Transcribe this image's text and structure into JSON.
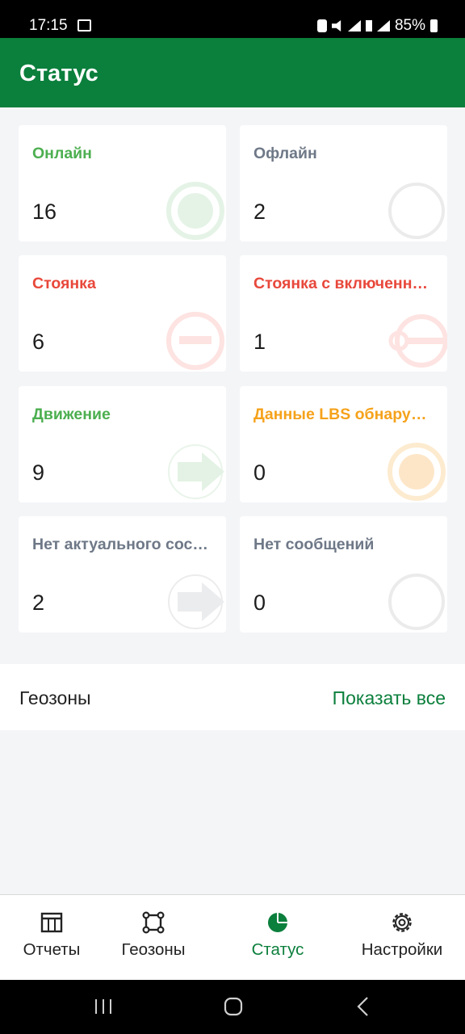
{
  "status_bar": {
    "time": "17:15",
    "battery": "85%"
  },
  "app_bar": {
    "title": "Статус"
  },
  "cards": [
    {
      "label": "Онлайн",
      "value": "16",
      "color": "#4caf50",
      "icon": "online-circle-icon"
    },
    {
      "label": "Офлайн",
      "value": "2",
      "color": "#6e7887",
      "icon": "offline-circle-icon"
    },
    {
      "label": "Стоянка",
      "value": "6",
      "color": "#e8483b",
      "icon": "parking-minus-icon"
    },
    {
      "label": "Стоянка с включенным зажиганием",
      "value": "1",
      "color": "#e8483b",
      "icon": "parking-key-icon"
    },
    {
      "label": "Движение",
      "value": "9",
      "color": "#4caf50",
      "icon": "moving-arrow-icon"
    },
    {
      "label": "Данные LBS обнаружены",
      "value": "0",
      "color": "#f5a21b",
      "icon": "lbs-dot-icon"
    },
    {
      "label": "Нет актуального состояния",
      "value": "2",
      "color": "#6e7887",
      "icon": "no-state-arrow-icon"
    },
    {
      "label": "Нет сообщений",
      "value": "0",
      "color": "#6e7887",
      "icon": "no-messages-circle-icon"
    }
  ],
  "geozones": {
    "label": "Геозоны",
    "link": "Показать все"
  },
  "bottom_nav": {
    "items": [
      {
        "label": "Отчеты",
        "icon": "reports-table-icon"
      },
      {
        "label": "Геозоны",
        "icon": "geozone-square-icon"
      },
      {
        "label": "Статус",
        "icon": "status-pie-icon",
        "active": true
      },
      {
        "label": "Настройки",
        "icon": "settings-gear-icon"
      }
    ]
  },
  "colors": {
    "brand": "#0b7f3c",
    "background": "#f4f5f7"
  }
}
